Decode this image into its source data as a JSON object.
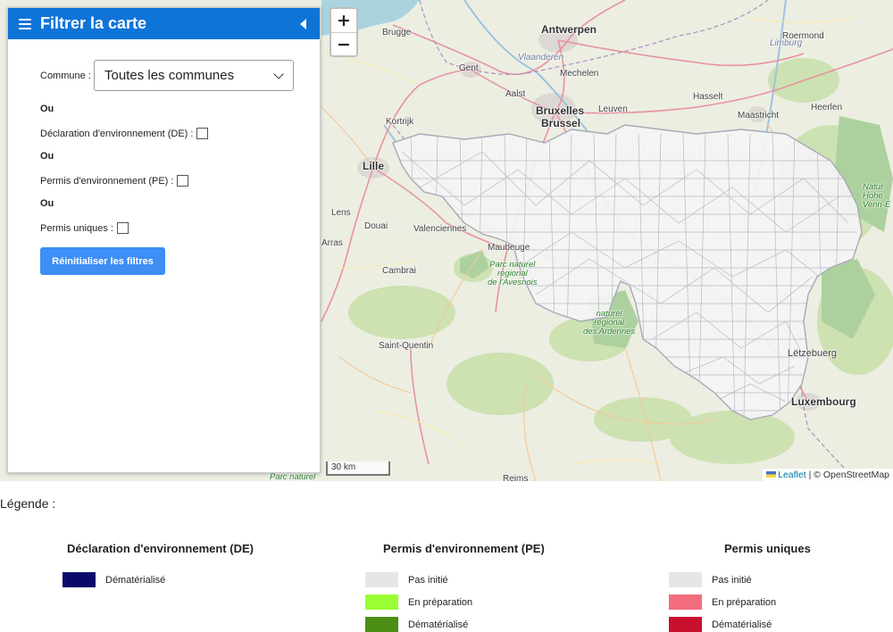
{
  "sidebar": {
    "title": "Filtrer la carte",
    "commune_label": "Commune :",
    "commune_select": "Toutes les communes",
    "or1": "Ou",
    "de_label": "Déclaration d'environnement (DE) :",
    "or2": "Ou",
    "pe_label": "Permis d'environnement (PE) :",
    "or3": "Ou",
    "pu_label": "Permis uniques :",
    "reset_button": "Réinitialiser les filtres"
  },
  "map": {
    "zoom_in": "+",
    "zoom_out": "−",
    "scale": "30 km",
    "attribution_leaflet": "Leaflet",
    "attribution_sep": " | © OpenStreetMap",
    "places": {
      "antwerpen": "Antwerpen",
      "brugge": "Brugge",
      "limburg": "Limburg",
      "roermond": "Roermond",
      "gent": "Gent",
      "vlaanderen": "Vlaanderen",
      "mechelen": "Mechelen",
      "hasselt": "Hasselt",
      "aalst": "Aalst",
      "bruxelles": "Bruxelles",
      "brussel": "Brussel",
      "leuven": "Leuven",
      "maastricht": "Maastricht",
      "heerlen": "Heerlen",
      "kortrijk": "Kortrijk",
      "lille": "Lille",
      "lens": "Lens",
      "douai": "Douai",
      "valenciennes": "Valenciennes",
      "arras": "Arras",
      "maubeuge": "Maubeuge",
      "cambrai": "Cambrai",
      "parc_avesnois": "Parc naturel\nrégional\nde l'Avesnois",
      "parc_ardennes": "naturel\nrégional\ndes Ardennes",
      "saint_quentin": "Saint-Quentin",
      "letzebuerg": "Lëtzebuerg",
      "luxembourg": "Luxembourg",
      "naturpark": "Natur\nHohe\nVenn-E",
      "parc_bottom": "Parc naturel",
      "reims": "Reims"
    }
  },
  "legend": {
    "title": "Légende :",
    "de": {
      "heading": "Déclaration d'environnement (DE)",
      "items": [
        {
          "label": "Dématérialisé",
          "color": "#0a0a6b"
        }
      ]
    },
    "pe": {
      "heading": "Permis d'environnement (PE)",
      "items": [
        {
          "label": "Pas initié",
          "color": "#e6e6e6"
        },
        {
          "label": "En préparation",
          "color": "#99ff33"
        },
        {
          "label": "Dématérialisé",
          "color": "#4a8f14"
        }
      ]
    },
    "pu": {
      "heading": "Permis uniques",
      "items": [
        {
          "label": "Pas initié",
          "color": "#e6e6e6"
        },
        {
          "label": "En préparation",
          "color": "#f36d7e"
        },
        {
          "label": "Dématérialisé",
          "color": "#c8102e"
        }
      ]
    }
  },
  "colors": {
    "header": "#0f74d8",
    "button": "#3d8ef5",
    "region_fill": "#f4f4f4",
    "region_border": "#a8a8b8"
  }
}
